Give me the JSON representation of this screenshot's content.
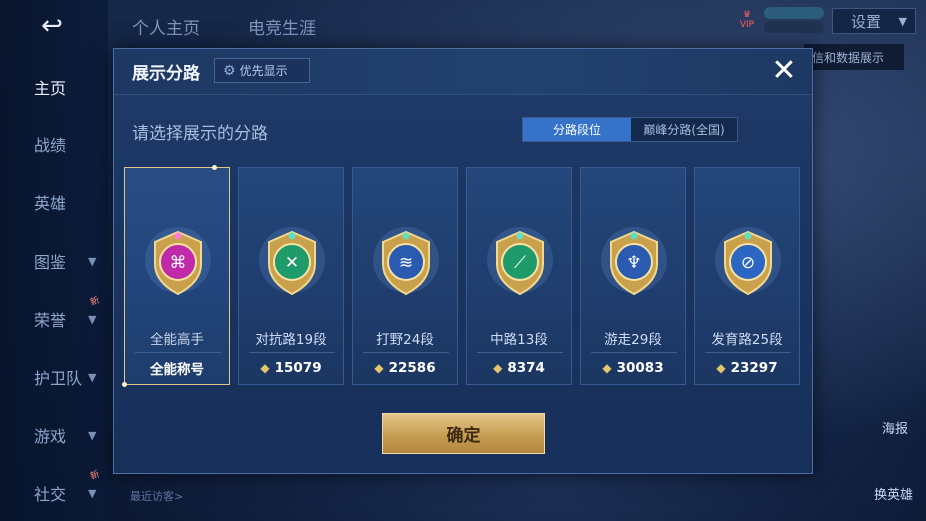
{
  "background": {
    "nav_items": [
      {
        "label": "主页",
        "chevron": false,
        "active": true
      },
      {
        "label": "战绩",
        "chevron": false,
        "active": false
      },
      {
        "label": "英雄",
        "chevron": false,
        "active": false
      },
      {
        "label": "图鉴",
        "chevron": true,
        "active": false
      },
      {
        "label": "荣誉",
        "chevron": true,
        "active": false,
        "badge": "新"
      },
      {
        "label": "护卫队",
        "chevron": true,
        "active": false
      },
      {
        "label": "游戏",
        "chevron": true,
        "active": false
      },
      {
        "label": "社交",
        "chevron": true,
        "active": false,
        "badge": "新"
      }
    ],
    "top_tabs": [
      "个人主页",
      "电竞生涯"
    ],
    "settings_label": "设置",
    "right_tip": "信和数据展示",
    "right_labels": [
      "海报",
      "换英雄"
    ],
    "visitors_label": "最近访客>"
  },
  "modal": {
    "title": "展示分路",
    "priority_label": "优先显示",
    "prompt": "请选择展示的分路",
    "segments": [
      "分路段位",
      "巅峰分路(全国)"
    ],
    "confirm_label": "确定",
    "cards": [
      {
        "label": "全能高手",
        "footer": "全能称号",
        "points": null,
        "icon": "all-round-medal-icon",
        "color": "#c02aa8",
        "selected": true
      },
      {
        "label": "对抗路19段",
        "footer": null,
        "points": "15079",
        "icon": "clash-lane-medal-icon",
        "color": "#1f9b6b",
        "selected": false
      },
      {
        "label": "打野24段",
        "footer": null,
        "points": "22586",
        "icon": "jungle-medal-icon",
        "color": "#2a5bb0",
        "selected": false
      },
      {
        "label": "中路13段",
        "footer": null,
        "points": "8374",
        "icon": "mid-lane-medal-icon",
        "color": "#1f9b6b",
        "selected": false
      },
      {
        "label": "游走29段",
        "footer": null,
        "points": "30083",
        "icon": "roam-medal-icon",
        "color": "#2a5bb0",
        "selected": false
      },
      {
        "label": "发育路25段",
        "footer": null,
        "points": "23297",
        "icon": "farm-lane-medal-icon",
        "color": "#2a66c2",
        "selected": false
      }
    ]
  },
  "colors": {
    "accent_blue": "#3473c9",
    "gold": "#e2c56d",
    "modal_bg": "#1f3b67"
  }
}
